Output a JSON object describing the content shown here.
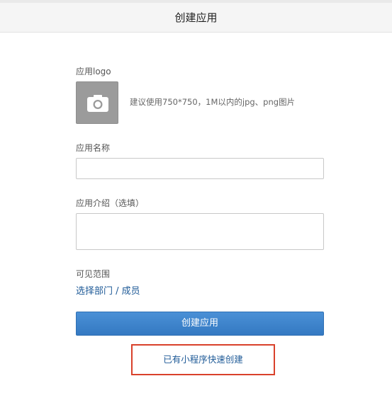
{
  "header": {
    "title": "创建应用"
  },
  "form": {
    "logo": {
      "label": "应用logo",
      "hint": "建议使用750*750，1M以内的jpg、png图片",
      "icon": "camera-icon"
    },
    "name": {
      "label": "应用名称",
      "value": "",
      "placeholder": ""
    },
    "description": {
      "label": "应用介绍（选填）",
      "value": "",
      "placeholder": ""
    },
    "visibility": {
      "label": "可见范围",
      "link": "选择部门 / 成员"
    },
    "submit_label": "创建应用",
    "miniapp_link": "已有小程序快速创建"
  },
  "colors": {
    "primary": "#3a82c9",
    "link": "#1e5a97",
    "highlight_border": "#d9412b",
    "header_bg": "#f5f5f5"
  }
}
